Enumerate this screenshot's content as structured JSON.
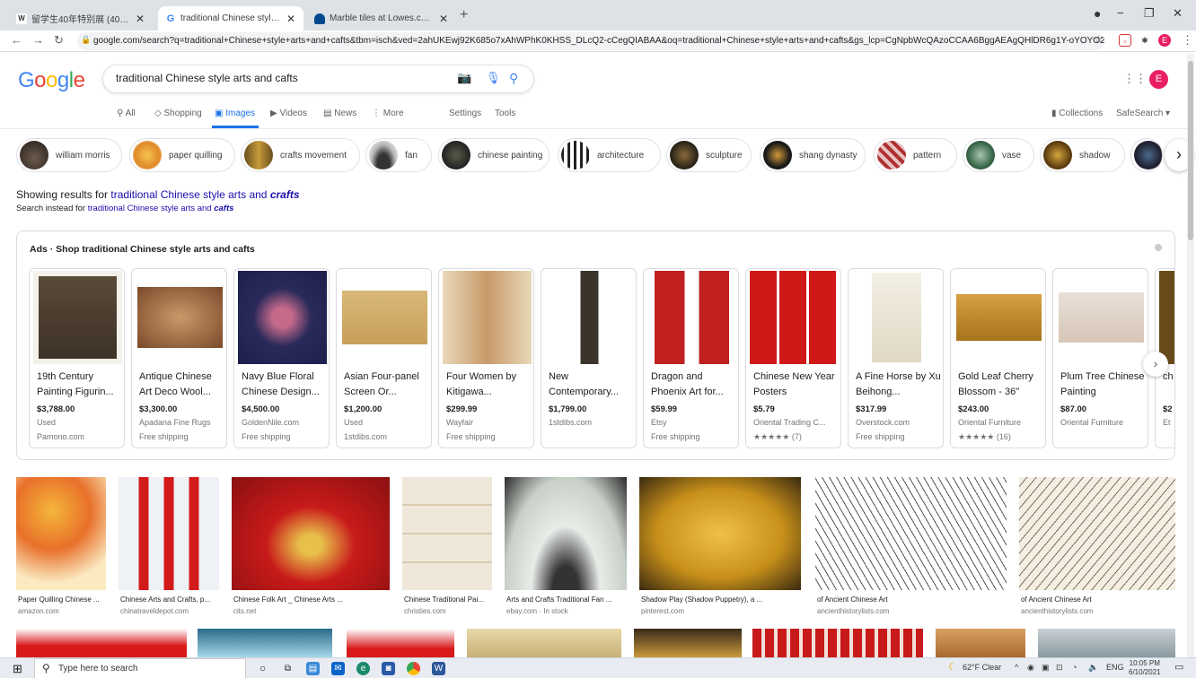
{
  "browser": {
    "tabs": [
      {
        "title": "留学生40年特别展 (40 Years of ...",
        "icon": "W"
      },
      {
        "title": "traditional Chinese style arts and ...",
        "icon": "G"
      },
      {
        "title": "Marble tiles at Lowes.com: Search ...",
        "icon": "L"
      }
    ],
    "url": "google.com/search?q=traditional+Chinese+style+arts+and+cafts&tbm=isch&ved=2ahUKEwj92K685o7xAhWPhK0KHSS_DLcQ2-cCegQIABAA&oq=traditional+Chinese+style+arts+and+cafts&gs_lcp=CgNpbWcQAzoCCAA6BggAEAgQHlDR6g1Y-oYOYO2LDm..."
  },
  "google": {
    "logo": "Google",
    "query": "traditional Chinese style arts and cafts",
    "avatar_letter": "E",
    "nav": [
      "All",
      "Shopping",
      "Images",
      "Videos",
      "News",
      "More"
    ],
    "settings": "Settings",
    "tools": "Tools",
    "collections": "Collections",
    "safesearch": "SafeSearch"
  },
  "chips": [
    "william morris",
    "paper quilling",
    "crafts movement",
    "fan",
    "chinese painting",
    "architecture",
    "sculpture",
    "shang dynasty",
    "pattern",
    "vase",
    "shadow"
  ],
  "showing": {
    "prefix": "Showing results for",
    "corrected_plain": "traditional Chinese style arts and",
    "corrected_bold": "crafts",
    "instead_prefix": "Search instead for",
    "instead_plain": "traditional Chinese style arts and",
    "instead_bold": "cafts"
  },
  "ads": {
    "title": "Ads · Shop traditional Chinese style arts and cafts",
    "items": [
      {
        "title": "19th Century Painting Figurin...",
        "price": "$3,788.00",
        "line1": "Used",
        "line2": "Pamono.com"
      },
      {
        "title": "Antique Chinese Art Deco Wool...",
        "price": "$3,300.00",
        "line1": "Apadana Fine Rugs",
        "line2": "Free shipping"
      },
      {
        "title": "Navy Blue Floral Chinese Design...",
        "price": "$4,500.00",
        "line1": "GoldenNile.com",
        "line2": "Free shipping"
      },
      {
        "title": "Asian Four-panel Screen Or...",
        "price": "$1,200.00",
        "line1": "Used",
        "line2": "1stdibs.com"
      },
      {
        "title": "Four Women by Kitigawa...",
        "price": "$299.99",
        "line1": "Wayfair",
        "line2": "Free shipping"
      },
      {
        "title": "New Contemporary...",
        "price": "$1,799.00",
        "line1": "1stdibs.com",
        "line2": ""
      },
      {
        "title": "Dragon and Phoenix Art for...",
        "price": "$59.99",
        "line1": "Etsy",
        "line2": "Free shipping"
      },
      {
        "title": "Chinese New Year Posters",
        "price": "$5.79",
        "line1": "Oriental Trading C...",
        "line2": "★★★★★ (7)"
      },
      {
        "title": "A Fine Horse by Xu Beihong...",
        "price": "$317.99",
        "line1": "Overstock.com",
        "line2": "Free shipping"
      },
      {
        "title": "Gold Leaf Cherry Blossom - 36\"",
        "price": "$243.00",
        "line1": "Oriental Furniture",
        "line2": "★★★★★ (16)"
      },
      {
        "title": "Plum Tree Chinese Painting",
        "price": "$87.00",
        "line1": "Oriental Furniture",
        "line2": ""
      },
      {
        "title": "ch Yu",
        "price": "$2",
        "line1": "Et",
        "line2": ""
      }
    ]
  },
  "results": [
    {
      "caption": "Paper Quilling Chinese ...",
      "source": "amazon.com"
    },
    {
      "caption": "Chinese Arts and Crafts, p...",
      "source": "chinatraveldepot.com"
    },
    {
      "caption": "Chinese Folk Art _ Chinese Arts ...",
      "source": "cits.net"
    },
    {
      "caption": "Chinese Traditional Pai...",
      "source": "christies.com"
    },
    {
      "caption": "Arts and Crafts Traditional Fan ...",
      "source": "ebay.com · In stock"
    },
    {
      "caption": "Shadow Play (Shadow Puppetry), a ...",
      "source": "pinterest.com"
    },
    {
      "caption": "of Ancient Chinese Art",
      "source": "ancienthistorylists.com"
    },
    {
      "caption": "of Ancient Chinese Art",
      "source": "ancienthistorylists.com"
    }
  ],
  "taskbar": {
    "search_placeholder": "Type here to search",
    "weather": "62°F Clear",
    "lang": "ENG",
    "time": "10:05 PM",
    "date": "6/10/2021"
  }
}
